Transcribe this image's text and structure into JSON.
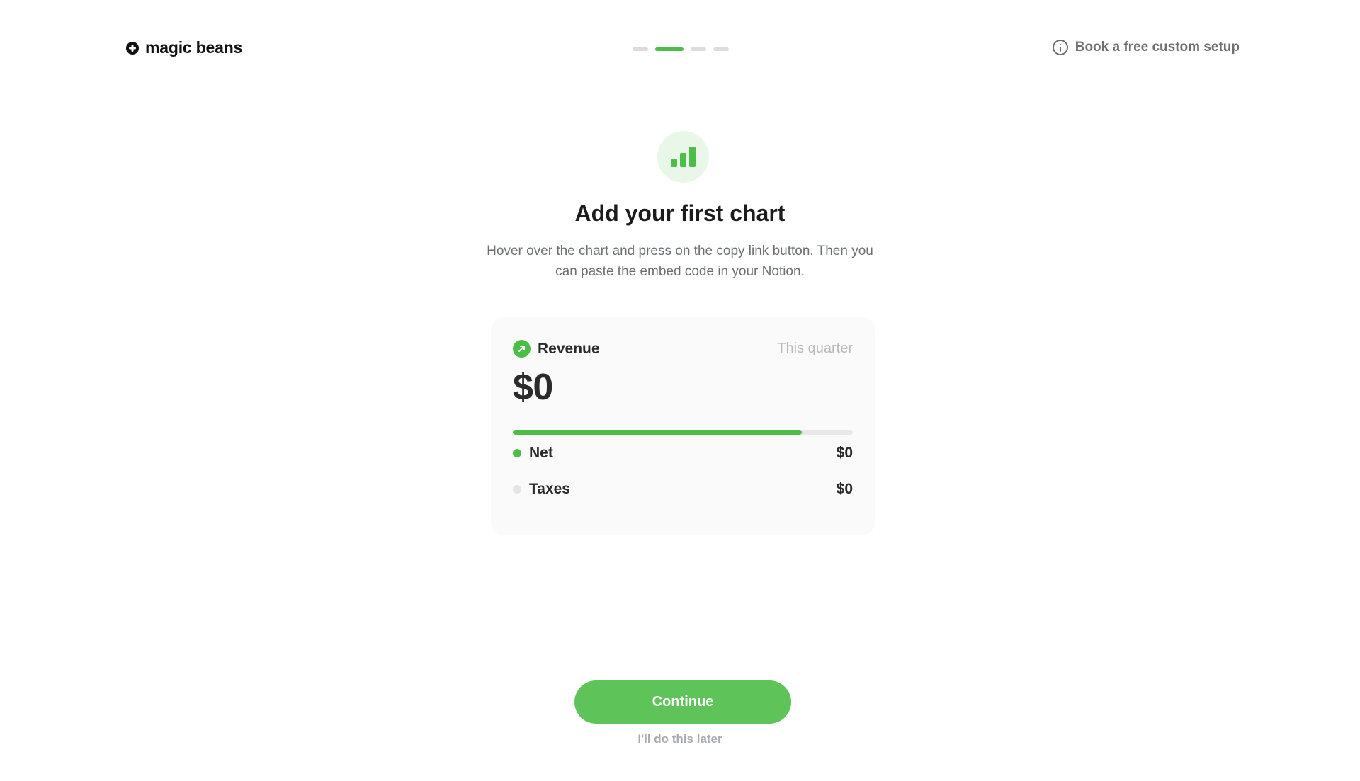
{
  "header": {
    "brand": "magic beans",
    "help_link": "Book a free custom setup",
    "steps": [
      {
        "active": false
      },
      {
        "active": true
      },
      {
        "active": false
      },
      {
        "active": false
      }
    ]
  },
  "hero": {
    "icon": "bar-chart-icon",
    "title": "Add your first chart",
    "subtitle": "Hover over the chart and press on the copy link button. Then you can paste the embed code in your Notion."
  },
  "card": {
    "icon": "trend-up-arrow-icon",
    "name": "Revenue",
    "period": "This quarter",
    "value": "$0",
    "progress_fraction": 0.85,
    "legend": [
      {
        "label": "Net",
        "value": "$0",
        "color": "#4cbe48"
      },
      {
        "label": "Taxes",
        "value": "$0",
        "color": "#e4e4e4"
      }
    ]
  },
  "actions": {
    "continue_label": "Continue",
    "later_label": "I'll do this later"
  },
  "colors": {
    "accent": "#4cbe48",
    "button": "#5ec459",
    "muted_text": "#6b6f75"
  }
}
